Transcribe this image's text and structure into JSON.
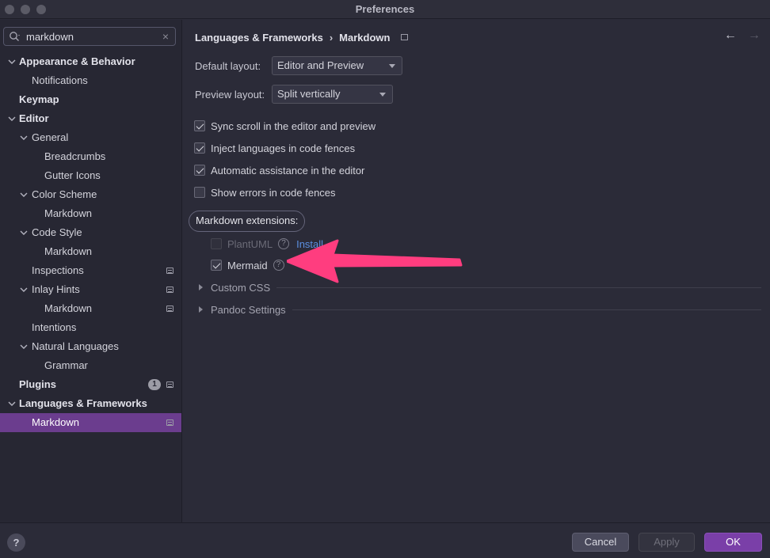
{
  "window": {
    "title": "Preferences"
  },
  "search": {
    "value": "markdown",
    "clear_icon": "×"
  },
  "sidebar": {
    "items": [
      {
        "label": "Appearance & Behavior",
        "level": 0,
        "bold": true,
        "expanded": true
      },
      {
        "label": "Notifications",
        "level": 1
      },
      {
        "label": "Keymap",
        "level": 0,
        "bold": true
      },
      {
        "label": "Editor",
        "level": 0,
        "bold": true,
        "expanded": true
      },
      {
        "label": "General",
        "level": 1,
        "expanded": true
      },
      {
        "label": "Breadcrumbs",
        "level": 2
      },
      {
        "label": "Gutter Icons",
        "level": 2
      },
      {
        "label": "Color Scheme",
        "level": 1,
        "expanded": true
      },
      {
        "label": "Markdown",
        "level": 2
      },
      {
        "label": "Code Style",
        "level": 1,
        "expanded": true
      },
      {
        "label": "Markdown",
        "level": 2
      },
      {
        "label": "Inspections",
        "level": 1,
        "project_icon": true
      },
      {
        "label": "Inlay Hints",
        "level": 1,
        "expanded": true,
        "project_icon": true
      },
      {
        "label": "Markdown",
        "level": 2,
        "project_icon": true
      },
      {
        "label": "Intentions",
        "level": 1
      },
      {
        "label": "Natural Languages",
        "level": 1,
        "expanded": true
      },
      {
        "label": "Grammar",
        "level": 2
      },
      {
        "label": "Plugins",
        "level": 0,
        "bold": true,
        "badge": "1",
        "project_icon": true
      },
      {
        "label": "Languages & Frameworks",
        "level": 0,
        "bold": true,
        "expanded": true
      },
      {
        "label": "Markdown",
        "level": 1,
        "selected": true,
        "project_icon": true
      }
    ]
  },
  "header": {
    "breadcrumb_parent": "Languages & Frameworks",
    "breadcrumb_separator": "›",
    "breadcrumb_current": "Markdown",
    "back_icon": "←",
    "forward_icon": "→"
  },
  "settings": {
    "default_layout_label": "Default layout:",
    "default_layout_value": "Editor and Preview",
    "preview_layout_label": "Preview layout:",
    "preview_layout_value": "Split vertically",
    "checkboxes": [
      {
        "label": "Sync scroll in the editor and preview",
        "checked": true
      },
      {
        "label": "Inject languages in code fences",
        "checked": true
      },
      {
        "label": "Automatic assistance in the editor",
        "checked": true
      },
      {
        "label": "Show errors in code fences",
        "checked": false
      }
    ],
    "extensions_label": "Markdown extensions:",
    "extensions": [
      {
        "label": "PlantUML",
        "checked": false,
        "disabled": true,
        "action": "Install"
      },
      {
        "label": "Mermaid",
        "checked": true,
        "disabled": false
      }
    ],
    "sections": [
      "Custom CSS",
      "Pandoc Settings"
    ],
    "help_glyph": "?"
  },
  "annotation": {
    "arrow_color": "#ff3d7f"
  },
  "footer": {
    "help_label": "?",
    "cancel_label": "Cancel",
    "apply_label": "Apply",
    "ok_label": "OK"
  }
}
